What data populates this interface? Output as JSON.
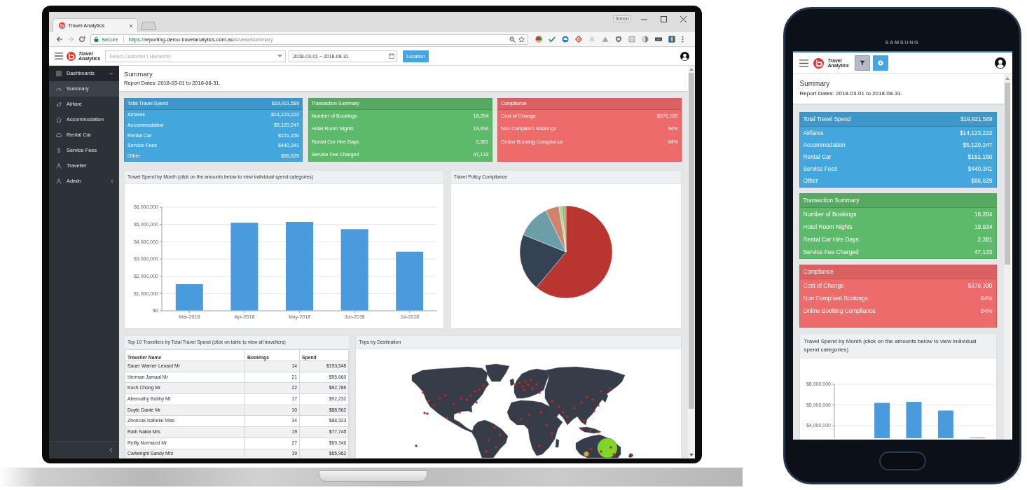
{
  "monitor": {
    "browser": {
      "tab_title": "Travel Analytics",
      "profile_name": "Simon",
      "nav_buttons": [
        {
          "kind": "back",
          "disabled": false
        },
        {
          "kind": "forward",
          "disabled": true
        },
        {
          "kind": "reload",
          "disabled": false
        }
      ],
      "address_bar": {
        "security_label": "Secure",
        "url": {
          "scheme": "https://",
          "host": "reporting-demo.travelanalytics.com.au",
          "path": "/#/view/summary"
        }
      }
    },
    "app": {
      "logo_text": "Travel Analytics",
      "customer_select": {
        "placeholder": "Select Customer | Hierarchy"
      },
      "date_range": {
        "value": "2018-03-01 ~ 2018-08-31"
      },
      "location_button": "Location",
      "sidebar": {
        "items": [
          {
            "label": "Dashboards",
            "selected": false,
            "expanded": true,
            "children": [
              {
                "label": "Summary",
                "selected": true
              },
              {
                "label": "Airfare",
                "selected": false
              },
              {
                "label": "Accommodation",
                "selected": false
              },
              {
                "label": "Rental Car",
                "selected": false
              },
              {
                "label": "Service Fees",
                "selected": false
              },
              {
                "label": "Traveller",
                "selected": false
              }
            ]
          },
          {
            "label": "Admin",
            "selected": false,
            "expanded": false
          }
        ]
      },
      "page_header": {
        "title": "Summary",
        "subtitle": "Report Dates: 2018-03-01 to 2018-08-31."
      },
      "summary_cards": [
        {
          "title": "Total Travel Spend",
          "total": "$19,921,589",
          "color": "#43a6dc",
          "rows": [
            {
              "label": "Airfares",
              "value": "$14,123,222"
            },
            {
              "label": "Accommodation",
              "value": "$5,120,247"
            },
            {
              "label": "Rental Car",
              "value": "$151,150"
            },
            {
              "label": "Service Fees",
              "value": "$440,341"
            },
            {
              "label": "Other",
              "value": "$86,629"
            }
          ]
        },
        {
          "title": "Transaction Summary",
          "color": "#5dba6b",
          "rows": [
            {
              "label": "Number of Bookings",
              "value": "16,204"
            },
            {
              "label": "Hotel Room Nights",
              "value": "19,934"
            },
            {
              "label": "Rental Car Hire Days",
              "value": "2,381"
            },
            {
              "label": "Service Fee Charged",
              "value": "47,133"
            }
          ]
        },
        {
          "title": "Compliance",
          "color": "#ee6b6b",
          "rows": [
            {
              "label": "Cost of Change",
              "value": "$376,330"
            },
            {
              "label": "Non Compliant Bookings",
              "value": "94%"
            },
            {
              "label": "Online Booking Compliance",
              "value": "84%"
            }
          ]
        }
      ],
      "spend_chart": {
        "title": "Travel Spend by Month (click on the amounts below to view individual spend categories)",
        "chart_data": {
          "type": "bar",
          "categories": [
            "Mar-2018",
            "Apr-2018",
            "May-2018",
            "Jun-2018",
            "Jul-2018"
          ],
          "values": [
            1540000,
            5100000,
            5150000,
            4730000,
            3420000
          ],
          "ylim": [
            0,
            6000000
          ],
          "yticks": [
            {
              "value": 0,
              "label": "$0"
            },
            {
              "value": 1000000,
              "label": "$1,000,000"
            },
            {
              "value": 2000000,
              "label": "$2,000,000"
            },
            {
              "value": 3000000,
              "label": "$3,000,000"
            },
            {
              "value": 4000000,
              "label": "$4,000,000"
            },
            {
              "value": 5000000,
              "label": "$5,000,000"
            },
            {
              "value": 6000000,
              "label": "$6,000,000"
            }
          ],
          "grid": true
        }
      },
      "compliance_chart": {
        "title": "Travel Policy Compliance"
      },
      "top_travellers": {
        "title": "Top 10 Travellers by Total Travel Spend (click on table to view all travellers)",
        "columns": [
          "Traveller Name",
          "Bookings",
          "Spend"
        ],
        "rows": [
          [
            "Sauer Warner Lenard Mr",
            "14",
            "$193,545"
          ],
          [
            "Herman Jamaal Mr",
            "21",
            "$95,660"
          ],
          [
            "Koch Chong Mr",
            "22",
            "$92,786"
          ],
          [
            "Abernathy Bobby Mr",
            "17",
            "$92,232"
          ],
          [
            "Doyle Dante Mr",
            "10",
            "$88,962"
          ],
          [
            "Zboncak Isabelle Miss",
            "34",
            "$88,323"
          ],
          [
            "Rath Nakia Mrs",
            "19",
            "$77,745"
          ],
          [
            "Reilly Normand Mr",
            "27",
            "$69,346"
          ],
          [
            "Cartwright Sandy Mrs",
            "19",
            "$65,962"
          ]
        ]
      },
      "destinations_map": {
        "title": "Trips by Destination"
      }
    }
  },
  "phone": {
    "brand": "SAMSUNG",
    "app": {
      "logo_text": "Travel Analytics",
      "page_header": {
        "title": "Summary",
        "subtitle": "Report Dates: 2018-03-01 to 2018-08-31."
      },
      "summary_cards": [
        {
          "title": "Total Travel Spend",
          "total": "$19,921,589",
          "color": "#43a6dc",
          "rows": [
            {
              "label": "Airfares",
              "value": "$14,123,222"
            },
            {
              "label": "Accommodation",
              "value": "$5,120,247"
            },
            {
              "label": "Rental Car",
              "value": "$151,150"
            },
            {
              "label": "Service Fees",
              "value": "$440,341"
            },
            {
              "label": "Other",
              "value": "$86,629"
            }
          ]
        },
        {
          "title": "Transaction Summary",
          "color": "#5dba6b",
          "rows": [
            {
              "label": "Number of Bookings",
              "value": "16,204"
            },
            {
              "label": "Hotel Room Nights",
              "value": "19,934"
            },
            {
              "label": "Rental Car Hire Days",
              "value": "2,381"
            },
            {
              "label": "Service Fee Charged",
              "value": "47,133"
            }
          ]
        },
        {
          "title": "Compliance",
          "color": "#ee6b6b",
          "rows": [
            {
              "label": "Cost of Change",
              "value": "$376,330"
            },
            {
              "label": "Non Compliant Bookings",
              "value": "94%"
            },
            {
              "label": "Online Booking Compliance",
              "value": "84%"
            }
          ]
        }
      ],
      "spend_chart": {
        "title": "Travel Spend by Month (click on the amounts below to view individual spend categories)",
        "chart_data": {
          "type": "bar",
          "values": [
            null,
            5100000,
            5150000,
            4730000,
            3420000
          ],
          "ylim": [
            3390000,
            6000000
          ],
          "yticks": [
            {
              "value": 4000000,
              "label": "$4,000,000"
            },
            {
              "value": 5000000,
              "label": "$5,000,000"
            },
            {
              "value": 6000000,
              "label": "$6,000,000"
            }
          ],
          "grid": true
        }
      }
    }
  }
}
